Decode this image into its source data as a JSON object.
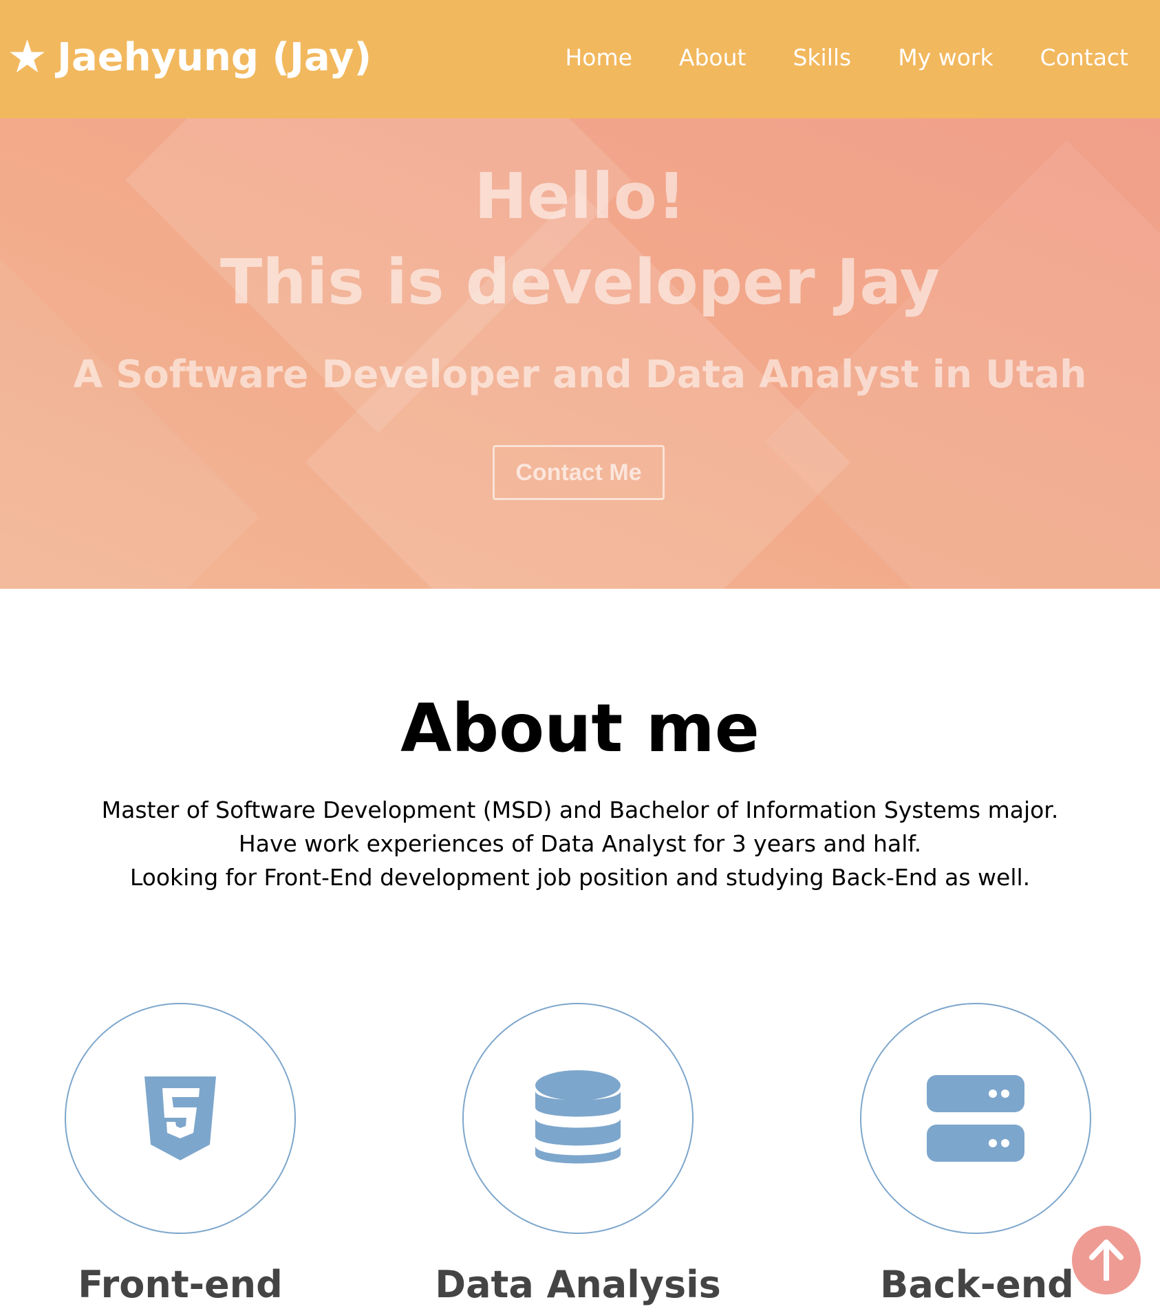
{
  "navbar": {
    "logo_text": "Jaehyung (Jay)",
    "items": [
      {
        "label": "Home"
      },
      {
        "label": "About"
      },
      {
        "label": "Skills"
      },
      {
        "label": "My work"
      },
      {
        "label": "Contact"
      }
    ]
  },
  "hero": {
    "title_line1": "Hello!",
    "title_line2": "This is developer Jay",
    "subtitle": "A Software Developer and Data Analyst in Utah",
    "button_label": "Contact Me"
  },
  "about": {
    "title": "About me",
    "lines": [
      "Master of Software Development (MSD) and Bachelor of Information Systems major.",
      "Have work experiences of Data Analyst for 3 years and half.",
      "Looking for Front-End development job position and studying Back-End as well."
    ]
  },
  "skills": [
    {
      "title": "Front-end",
      "icon": "html5-icon"
    },
    {
      "title": "Data Analysis",
      "icon": "database-icon"
    },
    {
      "title": "Back-end",
      "icon": "server-icon"
    }
  ],
  "colors": {
    "navbar": "#f2b85e",
    "hero": "#f1a98a",
    "icon": "#7da6cc",
    "scroll_top": "#ee9b94"
  },
  "scroll_top_icon": "arrow-up-icon"
}
